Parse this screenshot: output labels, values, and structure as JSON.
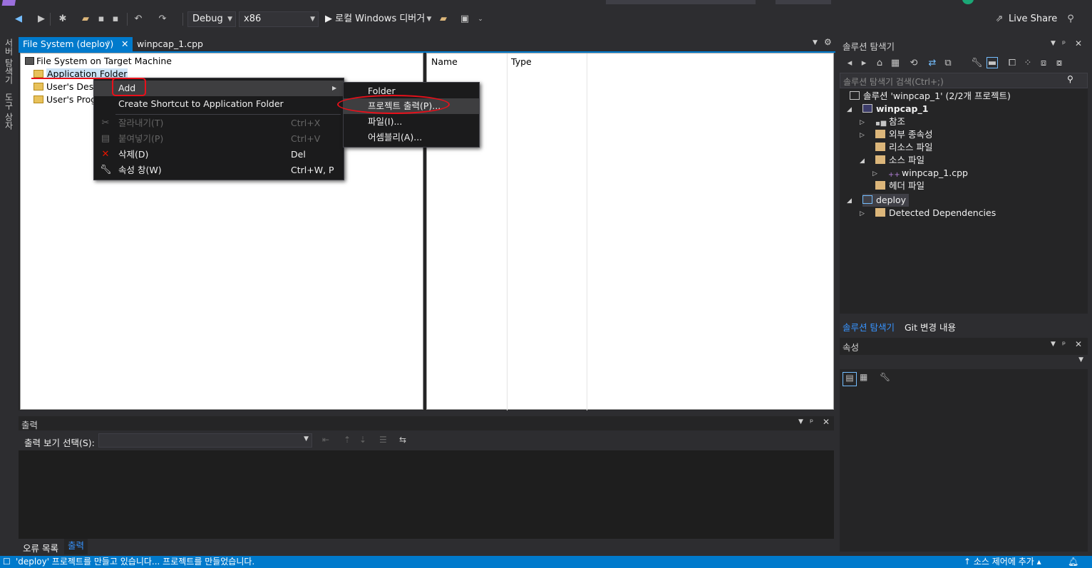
{
  "toolbar": {
    "config": "Debug",
    "platform": "x86",
    "run_label": "▶ 로컬 Windows 디버거",
    "live_share": "Live Share"
  },
  "left_strip": {
    "items": [
      "서버 탐색기",
      "도구 상자"
    ]
  },
  "doc_tabs": {
    "active": "File System (deploy)",
    "inactive": "winpcap_1.cpp"
  },
  "fs_tree": {
    "root": "File System on Target Machine",
    "items": [
      "Application Folder",
      "User's Deskt",
      "User's Progra"
    ]
  },
  "fs_list": {
    "col_name": "Name",
    "col_type": "Type"
  },
  "ctx_menu": {
    "items": [
      {
        "label": "Add",
        "shortcut": "",
        "icon": ""
      },
      {
        "label": "Create Shortcut to Application Folder",
        "shortcut": "",
        "icon": ""
      },
      {
        "label": "잘라내기(T)",
        "shortcut": "Ctrl+X",
        "icon": "cut-icon"
      },
      {
        "label": "붙여넣기(P)",
        "shortcut": "Ctrl+V",
        "icon": "paste-icon"
      },
      {
        "label": "삭제(D)",
        "shortcut": "Del",
        "icon": "delete-icon"
      },
      {
        "label": "속성 창(W)",
        "shortcut": "Ctrl+W, P",
        "icon": "wrench-icon"
      }
    ]
  },
  "submenu": {
    "items": [
      "Folder",
      "프로젝트 출력(P)...",
      "파일(I)...",
      "어셈블리(A)..."
    ]
  },
  "solution_explorer": {
    "title": "솔루션 탐색기",
    "search_placeholder": "솔루션 탐색기 검색(Ctrl+;)",
    "rows": [
      "솔루션 'winpcap_1' (2/2개 프로젝트)",
      "winpcap_1",
      "참조",
      "외부 종속성",
      "리소스 파일",
      "소스 파일",
      "winpcap_1.cpp",
      "헤더 파일",
      "deploy",
      "Detected Dependencies"
    ],
    "tab_active": "솔루션 탐색기",
    "tab_inactive": "Git 변경 내용"
  },
  "properties": {
    "title": "속성"
  },
  "output": {
    "title": "출력",
    "source_label": "출력 보기 선택(S):",
    "tab_errors": "오류 목록",
    "tab_output": "출력"
  },
  "status": {
    "message": "'deploy' 프로젝트를 만들고 있습니다... 프로젝트를 만들었습니다.",
    "right": "↑ 소스 제어에 추가 ▴"
  },
  "colors": {
    "accent": "#007acc",
    "annotation": "#e8101a",
    "bg": "#2d2d30"
  }
}
